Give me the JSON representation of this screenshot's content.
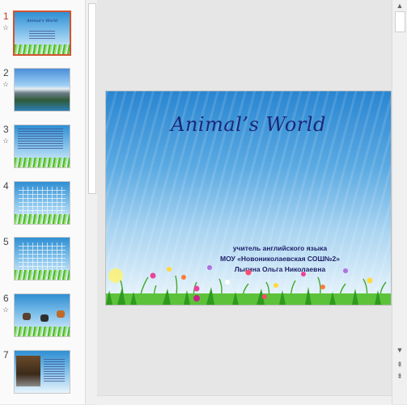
{
  "thumbnails": [
    {
      "number": "1",
      "starred": true,
      "active": true,
      "kind": "title",
      "title": "Animal's World"
    },
    {
      "number": "2",
      "starred": true,
      "active": false,
      "kind": "landscape"
    },
    {
      "number": "3",
      "starred": true,
      "active": false,
      "kind": "text"
    },
    {
      "number": "4",
      "starred": false,
      "active": false,
      "kind": "grid"
    },
    {
      "number": "5",
      "starred": false,
      "active": false,
      "kind": "grid"
    },
    {
      "number": "6",
      "starred": true,
      "active": false,
      "kind": "animals"
    },
    {
      "number": "7",
      "starred": false,
      "active": false,
      "kind": "photo"
    }
  ],
  "slide": {
    "title": "Animal’s World",
    "line1": "учитель английского языка",
    "line2": "МОУ «Новониколаевская СОШ№2»",
    "line3": "Лыгина Ольга Николаевна"
  },
  "icons": {
    "star": "☆",
    "scroll_up": "▲",
    "scroll_down": "▼",
    "prev_slide": "⇞",
    "next_slide": "⇟"
  },
  "colors": {
    "active_border": "#d35230",
    "title_color": "#1c2878",
    "text_color": "#1c1f66"
  }
}
